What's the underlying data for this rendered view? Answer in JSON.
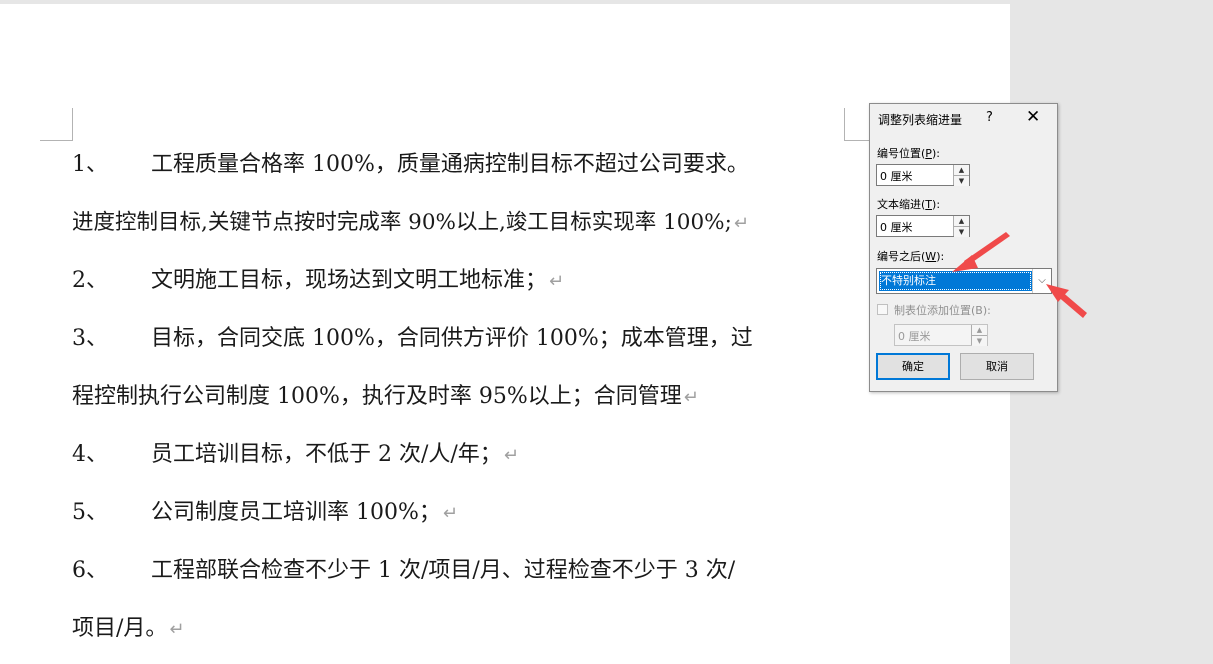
{
  "document": {
    "lines": [
      {
        "num": "1、",
        "text": "工程质量合格率 100%，质量通病控制目标不超过公司要求。",
        "mark": ""
      },
      {
        "num": "",
        "text": "进度控制目标,关键节点按时完成率 90%以上,竣工目标实现率 100%;",
        "mark": "↵"
      },
      {
        "num": "2、",
        "text": "文明施工目标，现场达到文明工地标准；",
        "mark": "↵"
      },
      {
        "num": "3、",
        "text": "目标，合同交底 100%，合同供方评价 100%；成本管理，过",
        "mark": ""
      },
      {
        "num": "",
        "text": "程控制执行公司制度 100%，执行及时率 95%以上；合同管理",
        "mark": "↵"
      },
      {
        "num": "4、",
        "text": "员工培训目标，不低于 2 次/人/年；",
        "mark": "↵"
      },
      {
        "num": "5、",
        "text": "公司制度员工培训率 100%；",
        "mark": "↵"
      },
      {
        "num": "6、",
        "text": "工程部联合检查不少于 1 次/项目/月、过程检查不少于 3 次/",
        "mark": ""
      },
      {
        "num": "",
        "text": "项目/月。",
        "mark": "↵"
      }
    ]
  },
  "dialog": {
    "title": "调整列表缩进量",
    "help": "?",
    "close": "✕",
    "number_position": {
      "label": "编号位置(",
      "key": "P",
      "suffix": "):",
      "value": "0 厘米"
    },
    "text_indent": {
      "label": "文本缩进(",
      "key": "T",
      "suffix": "):",
      "value": "0 厘米"
    },
    "after_number": {
      "label": "编号之后(",
      "key": "W",
      "suffix": "):",
      "value": "不特别标注"
    },
    "tab_stop": {
      "label": "制表位添加位置(B):",
      "value": "0 厘米",
      "checked": false
    },
    "ok": "确定",
    "cancel": "取消"
  },
  "annotation_color": "#f04a4a"
}
